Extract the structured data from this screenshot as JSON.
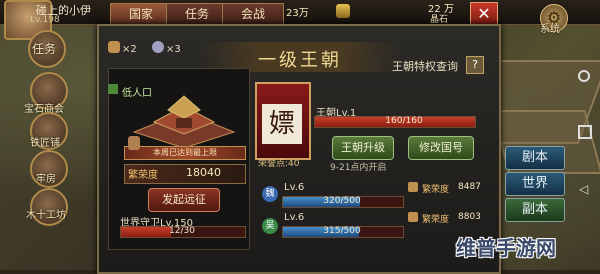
{
  "header": {
    "player_name": "碰上的小伊",
    "player_level": "Lv.198",
    "tabs": [
      "国家",
      "任务",
      "会战"
    ],
    "resource_value": "23万",
    "resource_value2": "22 万",
    "resource_label": "晶石",
    "settings_label": "系统"
  },
  "sidebar": {
    "items": [
      {
        "label": "任务",
        "icon": "quest-icon"
      },
      {
        "label": "宝石商会",
        "icon": "gem-shop-icon"
      },
      {
        "label": "铁匠铺",
        "icon": "blacksmith-icon"
      },
      {
        "label": "牢房",
        "icon": "prison-icon"
      },
      {
        "label": "木十工坊",
        "icon": "workshop-icon"
      }
    ]
  },
  "panel": {
    "title": "一级王朝",
    "count_1": "×2",
    "count_2": "×3",
    "privilege_query": "王朝特权查询",
    "population_label": "低人口",
    "city_caption": "本周已达到最上限",
    "honor_label": "繁荣度",
    "honor_value": "18040",
    "expedition_button": "发起远征",
    "world_guard_label": "世界守卫Lv.150",
    "world_guard_progress": "12/30",
    "world_guard_ratio": 0.4,
    "rank_char": "嫖",
    "rank_sub": "荣誉点:40",
    "dynasty_level": "王朝Lv.1",
    "dynasty_progress": "160/160",
    "dynasty_ratio": 1.0,
    "upgrade_button": "王朝升级",
    "rename_button": "修改国号",
    "open_time": "9-21点内开启",
    "rows": [
      {
        "kingdom": "魏",
        "level": "Lv.6",
        "progress": "320/500",
        "ratio": 0.64,
        "honor_label": "繁荣度",
        "honor_value": "8487",
        "color": "#3a6ab0"
      },
      {
        "kingdom": "吴",
        "level": "Lv.6",
        "progress": "315/500",
        "ratio": 0.63,
        "honor_label": "繁荣度",
        "honor_value": "8803",
        "color": "#3a8a4a"
      }
    ]
  },
  "right_buttons": [
    "剧本",
    "世界",
    "副本"
  ],
  "watermark": "维普手游网"
}
